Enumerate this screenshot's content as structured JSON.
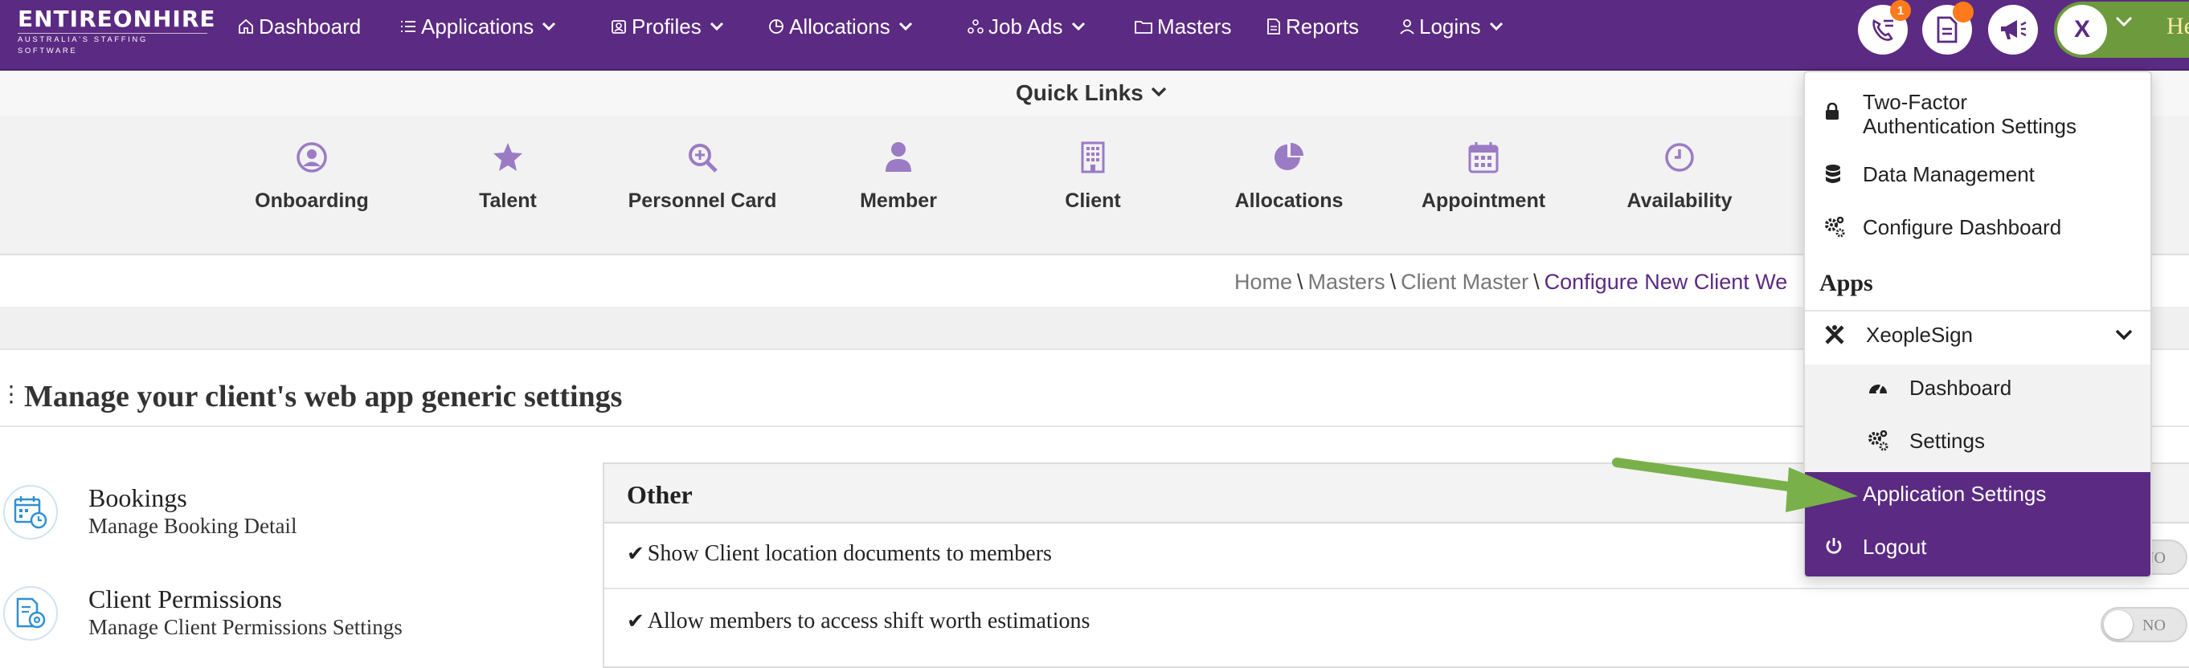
{
  "brand": {
    "name": "ENTIREONHIRE",
    "tagline": "AUSTRALIA'S STAFFING SOFTWARE"
  },
  "topnav": {
    "items": [
      {
        "label": "Dashboard",
        "icon": "home-icon"
      },
      {
        "label": "Applications",
        "icon": "list-icon"
      },
      {
        "label": "Profiles",
        "icon": "id-card-icon"
      },
      {
        "label": "Allocations",
        "icon": "pie-icon"
      },
      {
        "label": "Job Ads",
        "icon": "network-icon"
      },
      {
        "label": "Masters",
        "icon": "folder-icon"
      },
      {
        "label": "Reports",
        "icon": "document-icon"
      },
      {
        "label": "Logins",
        "icon": "user-icon"
      }
    ],
    "call_badge": "1",
    "avatar_letter": "X",
    "greeting_partial": "He"
  },
  "quick_links": {
    "title": "Quick Links",
    "items": [
      {
        "label": "Onboarding",
        "icon": "user-circle-icon"
      },
      {
        "label": "Talent",
        "icon": "star-icon"
      },
      {
        "label": "Personnel Card",
        "icon": "search-plus-icon"
      },
      {
        "label": "Member",
        "icon": "person-icon"
      },
      {
        "label": "Client",
        "icon": "building-icon"
      },
      {
        "label": "Allocations",
        "icon": "pie-chart-icon"
      },
      {
        "label": "Appointment",
        "icon": "calendar-icon"
      },
      {
        "label": "Availability",
        "icon": "clock-icon"
      }
    ]
  },
  "breadcrumb": {
    "home": "Home",
    "masters": "Masters",
    "client_master": "Client Master",
    "current": "Configure New Client We",
    "separator": "\\"
  },
  "page": {
    "title": "Manage your client's web app generic settings",
    "sidebar": [
      {
        "title": "Bookings",
        "subtitle": "Manage Booking Detail",
        "icon": "calendar-clock-icon"
      },
      {
        "title": "Client Permissions",
        "subtitle": "Manage Client Permissions Settings",
        "icon": "document-gear-icon"
      }
    ],
    "panel_title": "Other",
    "options": [
      {
        "label": "Show Client location documents to members",
        "state": "NO",
        "check": "✔"
      },
      {
        "label": "Allow members to access shift worth estimations",
        "state": "NO",
        "check": "✔"
      }
    ]
  },
  "user_menu": {
    "items": [
      {
        "label_line1": "Two-Factor",
        "label_line2": "Authentication Settings",
        "icon": "lock-icon"
      },
      {
        "label": "Data Management",
        "icon": "database-icon"
      },
      {
        "label": "Configure Dashboard",
        "icon": "gears-icon"
      }
    ],
    "apps_heading": "Apps",
    "xeoplesign": {
      "label": "XeopleSign",
      "icon": "xeoplesign-icon"
    },
    "xeoplesign_sub": [
      {
        "label": "Dashboard",
        "icon": "tachometer-icon"
      },
      {
        "label": "Settings",
        "icon": "gears-icon"
      }
    ],
    "application_settings": "Application Settings",
    "logout": "Logout"
  },
  "colors": {
    "brand_purple": "#5b2a82",
    "quick_icon_purple": "#9b7bc4",
    "arrow_green": "#79b04a",
    "badge_orange": "#ff7a1a",
    "sidebar_icon_blue": "#2f8fd2"
  }
}
